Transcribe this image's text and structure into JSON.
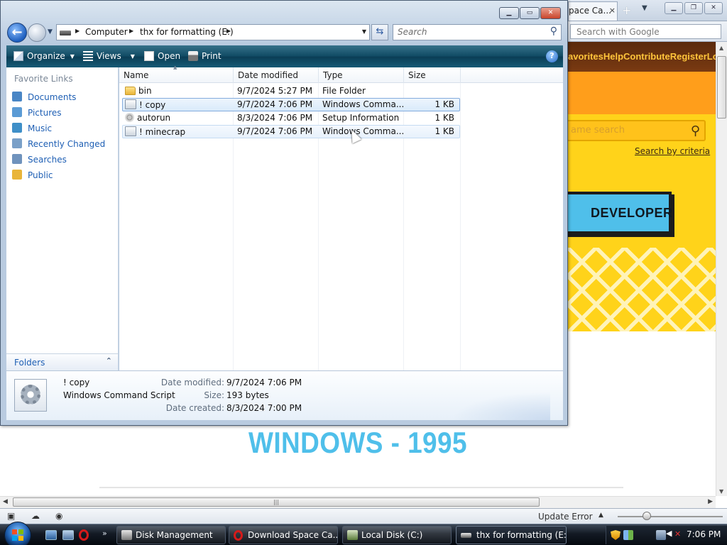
{
  "browser": {
    "tab_title": "pace Ca...",
    "tab_close": "×",
    "tab_add": "+",
    "tab_list": "▼",
    "window_buttons": {
      "min": "▁",
      "max": "❐",
      "close": "✕"
    },
    "search_placeholder": "Search with Google",
    "site": {
      "nav_text": "avoritesHelpContributeRegisterLogin",
      "search_placeholder": "ame search",
      "search_by_criteria": "Search by criteria",
      "developer_button": "DEVELOPER",
      "big_heading": "WINDOWS - 1995"
    },
    "status": {
      "update_error": "Update Error",
      "update_arrow": "▲"
    },
    "colors": {
      "site_yellow": "#ffd31a",
      "site_accent_blue": "#4fbfea",
      "site_nav_brown": "#5a2a0c"
    }
  },
  "explorer": {
    "window_buttons": {
      "min": "▁",
      "max": "▭",
      "close": "✕"
    },
    "address": {
      "crumbs": [
        "Computer",
        "thx for formatting (E:)"
      ],
      "arrow": "▶",
      "dropdown": "▼"
    },
    "refresh_symbol": "⇆",
    "search_placeholder": "Search",
    "toolbar": {
      "organize": "Organize",
      "views": "Views",
      "open": "Open",
      "print": "Print",
      "caret": "▼",
      "help": "?"
    },
    "nav_pane": {
      "header": "Favorite Links",
      "links": [
        {
          "label": "Documents",
          "icon": "documents-icon",
          "color": "#4a86c5"
        },
        {
          "label": "Pictures",
          "icon": "pictures-icon",
          "color": "#5b9bd5"
        },
        {
          "label": "Music",
          "icon": "music-icon",
          "color": "#3f8fc8"
        },
        {
          "label": "Recently Changed",
          "icon": "recently-changed-icon",
          "color": "#7aa0c8"
        },
        {
          "label": "Searches",
          "icon": "searches-icon",
          "color": "#6f93bd"
        },
        {
          "label": "Public",
          "icon": "public-folder-icon",
          "color": "#e9b53a"
        }
      ],
      "folders_label": "Folders",
      "folders_chevron": "⌃"
    },
    "columns": [
      "Name",
      "Date modified",
      "Type",
      "Size"
    ],
    "sort_indicator": "▲",
    "files": [
      {
        "name": "bin",
        "date": "9/7/2024 5:27 PM",
        "type": "File Folder",
        "size": "",
        "icon": "folder-icon",
        "state": "normal"
      },
      {
        "name": "! copy",
        "date": "9/7/2024 7:06 PM",
        "type": "Windows Comma...",
        "size": "1 KB",
        "icon": "script-icon",
        "state": "selected"
      },
      {
        "name": "autorun",
        "date": "8/3/2024 7:06 PM",
        "type": "Setup Information",
        "size": "1 KB",
        "icon": "setup-info-icon",
        "state": "normal"
      },
      {
        "name": "! minecrap",
        "date": "9/7/2024 7:06 PM",
        "type": "Windows Comma...",
        "size": "1 KB",
        "icon": "script-icon",
        "state": "hover"
      }
    ],
    "details": {
      "name": "! copy",
      "type": "Windows Command Script",
      "date_modified_label": "Date modified:",
      "date_modified": "9/7/2024 7:06 PM",
      "size_label": "Size:",
      "size": "193 bytes",
      "date_created_label": "Date created:",
      "date_created": "8/3/2024 7:00 PM"
    }
  },
  "taskbar": {
    "quick_launch_more": "»",
    "buttons": [
      {
        "label": "Disk Management",
        "icon": "disk-management-icon",
        "active": false
      },
      {
        "label": "Download Space Ca...",
        "icon": "opera-icon",
        "active": false
      },
      {
        "label": "Local Disk (C:)",
        "icon": "local-disk-icon",
        "active": false
      },
      {
        "label": "thx for formatting (E:)",
        "icon": "drive-icon",
        "active": true
      }
    ],
    "tray": {
      "volume": "◀",
      "muted": "✕",
      "clock": "7:06 PM"
    }
  }
}
